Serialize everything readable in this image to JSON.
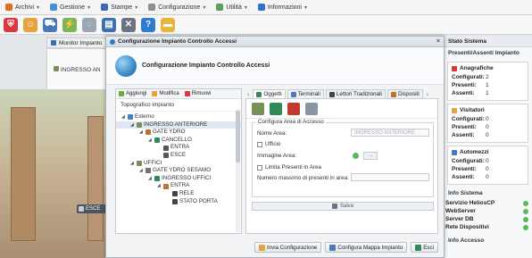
{
  "menubar": {
    "items": [
      {
        "label": "Archivi",
        "icon": "archive-icon",
        "color": "#e06c2b"
      },
      {
        "label": "Gestione",
        "icon": "users-icon",
        "color": "#4a8fd6"
      },
      {
        "label": "Stampe",
        "icon": "printer-icon",
        "color": "#3a6ab0"
      },
      {
        "label": "Configurazione",
        "icon": "tools-icon",
        "color": "#8a8f96"
      },
      {
        "label": "Utilità",
        "icon": "utility-icon",
        "color": "#5aa05a"
      },
      {
        "label": "Informazioni",
        "icon": "info-icon",
        "color": "#2e75c7"
      }
    ]
  },
  "toolbar": {
    "icons": [
      {
        "name": "shield-icon",
        "color": "#d9363e"
      },
      {
        "name": "people-icon",
        "color": "#e6a23c"
      },
      {
        "name": "car-icon",
        "color": "#4a79b8"
      },
      {
        "name": "plug-icon",
        "color": "#7db35a"
      },
      {
        "name": "spinner-icon",
        "color": "#9aa6b3"
      },
      {
        "name": "card-icon",
        "color": "#3d6fb5"
      },
      {
        "name": "tools-icon",
        "color": "#6b7280"
      },
      {
        "name": "help-icon",
        "color": "#2f7bd1"
      },
      {
        "name": "folder-icon",
        "color": "#e8b63a"
      }
    ]
  },
  "background": {
    "monitor_tab": "Monitor Impianto",
    "ingresso_label": "INGRESSO AN",
    "esce_chip": "ESCE"
  },
  "dialog": {
    "title": "Configurazione Impianto Controllo Accessi",
    "header_title": "Configurazione Impianto Controllo Accessi",
    "close": "×",
    "left": {
      "toolbar": [
        "Aggiungi",
        "Modifica",
        "Rimuovi"
      ],
      "section": "Topografico impianto",
      "tree": [
        {
          "label": "Esterno",
          "level": 0,
          "icon": "globe-icon",
          "color": "#3a86c8",
          "arrow": "◢"
        },
        {
          "label": "INGRESSO ANTERIORE",
          "level": 1,
          "icon": "road-icon",
          "color": "#7a8f5a",
          "arrow": "◢",
          "selected": true
        },
        {
          "label": "GATE YDRO",
          "level": 2,
          "icon": "gate-icon",
          "color": "#b8742a",
          "arrow": "◢"
        },
        {
          "label": "CANCELLO",
          "level": 3,
          "icon": "terminal-icon",
          "color": "#2e8b57",
          "arrow": "◢"
        },
        {
          "label": "ENTRA",
          "level": 4,
          "icon": "car-icon",
          "color": "#555555",
          "arrow": ""
        },
        {
          "label": "ESCE",
          "level": 4,
          "icon": "car-icon",
          "color": "#555555",
          "arrow": ""
        },
        {
          "label": "UFFICI",
          "level": 1,
          "icon": "road-icon",
          "color": "#7a8f5a",
          "arrow": "◢"
        },
        {
          "label": "GATE YDRO SESAMO",
          "level": 2,
          "icon": "gate-icon",
          "color": "#6b7280",
          "arrow": "◢"
        },
        {
          "label": "INGRESSO UFFICI",
          "level": 3,
          "icon": "terminal-icon",
          "color": "#2e8b57",
          "arrow": "◢"
        },
        {
          "label": "ENTRA",
          "level": 4,
          "icon": "person-icon",
          "color": "#b8742a",
          "arrow": "◢"
        },
        {
          "label": "RELE",
          "level": 5,
          "icon": "relay-icon",
          "color": "#444444",
          "arrow": ""
        },
        {
          "label": "STATO PORTA",
          "level": 5,
          "icon": "relay-icon",
          "color": "#444444",
          "arrow": ""
        }
      ]
    },
    "right": {
      "tabs": [
        {
          "label": "Oggetti",
          "color": "#2e8b57",
          "active": true
        },
        {
          "label": "Terminali",
          "color": "#4a79b8",
          "active": false
        },
        {
          "label": "Lettori Tradizionali",
          "color": "#444444",
          "active": false
        },
        {
          "label": "Dispositi",
          "color": "#b8742a",
          "active": false
        }
      ],
      "tab_prev": "‹",
      "tab_next": "›",
      "object_icons": [
        {
          "name": "road-icon",
          "color": "#7a8f5a"
        },
        {
          "name": "terminal-icon",
          "color": "#2e8b57"
        },
        {
          "name": "person-door-icon",
          "color": "#c0392b"
        },
        {
          "name": "barrier-icon",
          "color": "#8a96a3"
        }
      ],
      "fieldset_legend": "Configura Area di Accesso",
      "nome_area_label": "Nome Area:",
      "nome_area_value": "INGRESSO ANTERIORE",
      "ufficio_label": "Ufficio",
      "immagine_label": "Immagine Area:",
      "immagine_btn": "...",
      "limita_label": "Limita Presenti in Area",
      "max_label": "Numero massimo di presenti in area:",
      "max_value": "",
      "save_label": "Salva"
    },
    "footer": {
      "invia": "Invia Configurazione",
      "mappa": "Configura Mappa Impianto",
      "esci": "Esci"
    }
  },
  "side": {
    "stato_sistema": "Stato Sistema",
    "presenti_assenti": "Presenti/Assenti Impianto",
    "anagrafiche": {
      "title": "Anagrafiche",
      "rows": [
        {
          "k": "Configurati:",
          "v": "2"
        },
        {
          "k": "Presenti:",
          "v": "1"
        },
        {
          "k": "Assenti:",
          "v": "1"
        }
      ]
    },
    "visitatori": {
      "title": "Visitatori",
      "rows": [
        {
          "k": "Configurati:",
          "v": "0"
        },
        {
          "k": "Presenti:",
          "v": "0"
        },
        {
          "k": "Assenti:",
          "v": "0"
        }
      ]
    },
    "automezzi": {
      "title": "Automezzi",
      "rows": [
        {
          "k": "Configurati:",
          "v": "0"
        },
        {
          "k": "Presenti:",
          "v": "0"
        },
        {
          "k": "Assenti:",
          "v": "0"
        }
      ]
    },
    "info_sistema": "Info Sistema",
    "system": [
      {
        "label": "Servizio HeliosCP",
        "status_color": "#5cb85c"
      },
      {
        "label": "WebServer",
        "status_color": "#5cb85c"
      },
      {
        "label": "Server DB",
        "status_color": "#5cb85c"
      },
      {
        "label": "Rete Dispositivi",
        "status_color": "#5cb85c"
      }
    ],
    "info_accesso": "Info Accesso"
  }
}
